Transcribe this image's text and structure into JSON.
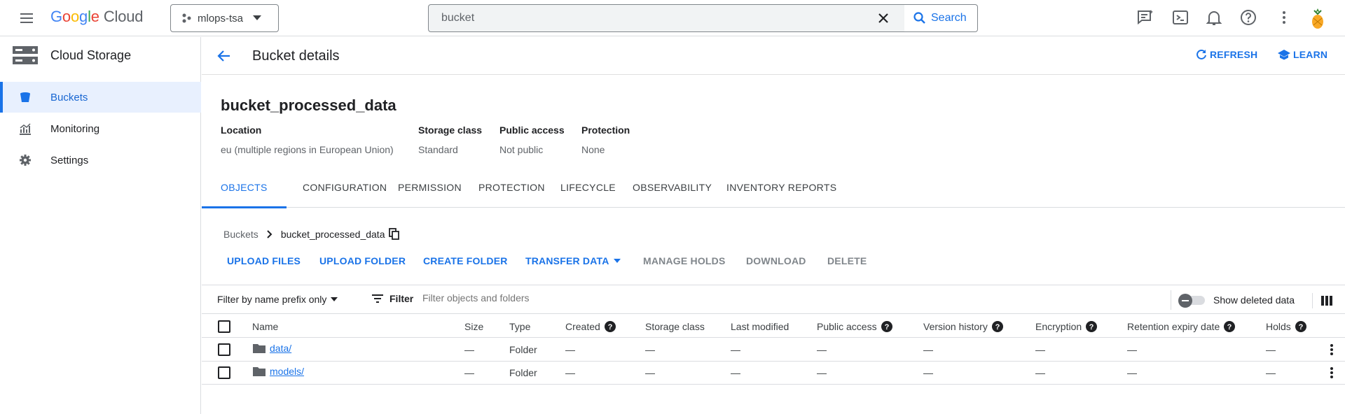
{
  "topbar": {
    "logo_google": [
      "G",
      "o",
      "o",
      "g",
      "l",
      "e"
    ],
    "logo_cloud": "Cloud",
    "project": "mlops-tsa",
    "search_value": "bucket",
    "search_button": "Search",
    "icons": [
      "gemini-chat-icon",
      "cloud-shell-icon",
      "notifications-icon",
      "help-icon",
      "more-vert-icon",
      "avatar"
    ]
  },
  "sidebar": {
    "title": "Cloud Storage",
    "items": [
      {
        "label": "Buckets",
        "icon": "bucket-icon",
        "active": true
      },
      {
        "label": "Monitoring",
        "icon": "monitoring-icon",
        "active": false
      },
      {
        "label": "Settings",
        "icon": "gear-icon",
        "active": false
      }
    ]
  },
  "page": {
    "title": "Bucket details",
    "refresh": "REFRESH",
    "learn": "LEARN"
  },
  "bucket": {
    "name": "bucket_processed_data",
    "meta": [
      {
        "key": "Location",
        "value": "eu (multiple regions in European Union)"
      },
      {
        "key": "Storage class",
        "value": "Standard"
      },
      {
        "key": "Public access",
        "value": "Not public"
      },
      {
        "key": "Protection",
        "value": "None"
      }
    ]
  },
  "tabs": [
    "OBJECTS",
    "CONFIGURATION",
    "PERMISSION",
    "PROTECTION",
    "LIFECYCLE",
    "OBSERVABILITY",
    "INVENTORY REPORTS"
  ],
  "breadcrumb": {
    "root": "Buckets",
    "current": "bucket_processed_data"
  },
  "actions": {
    "upload_files": "UPLOAD FILES",
    "upload_folder": "UPLOAD FOLDER",
    "create_folder": "CREATE FOLDER",
    "transfer_data": "TRANSFER DATA",
    "manage_holds": "MANAGE HOLDS",
    "download": "DOWNLOAD",
    "delete": "DELETE"
  },
  "filter": {
    "prefix_label": "Filter by name prefix only",
    "filter_label": "Filter",
    "placeholder": "Filter objects and folders",
    "show_deleted": "Show deleted data"
  },
  "table": {
    "headers": {
      "name": "Name",
      "size": "Size",
      "type": "Type",
      "created": "Created",
      "storage_class": "Storage class",
      "last_modified": "Last modified",
      "public_access": "Public access",
      "version_history": "Version history",
      "encryption": "Encryption",
      "retention": "Retention expiry date",
      "holds": "Holds"
    },
    "rows": [
      {
        "name": "data/",
        "size": "—",
        "type": "Folder",
        "created": "—",
        "storage_class": "—",
        "last_modified": "—",
        "public_access": "—",
        "version_history": "—",
        "encryption": "—",
        "retention": "—",
        "holds": "—"
      },
      {
        "name": "models/",
        "size": "—",
        "type": "Folder",
        "created": "—",
        "storage_class": "—",
        "last_modified": "—",
        "public_access": "—",
        "version_history": "—",
        "encryption": "—",
        "retention": "—",
        "holds": "—"
      }
    ]
  },
  "colors": {
    "accent": "#1a73e8",
    "active_bg": "#e8f0fe",
    "border": "#dadce0"
  }
}
